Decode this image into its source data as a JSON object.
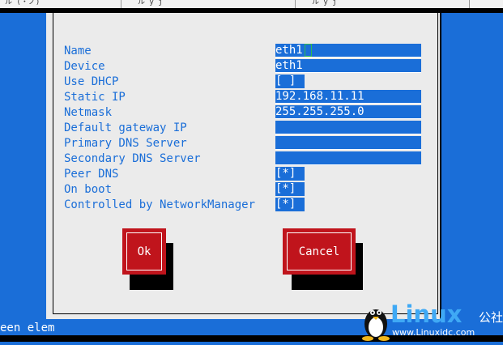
{
  "window": {
    "tabs": [
      {
        "label": "ル     (・ノ)"
      },
      {
        "label": "ル       y   j"
      },
      {
        "label": "ル       y   j"
      }
    ]
  },
  "form": {
    "fields": [
      {
        "label": "Name",
        "value": "eth1",
        "type": "text"
      },
      {
        "label": "Device",
        "value": "eth1",
        "type": "text"
      },
      {
        "label": "Use DHCP",
        "value": "[ ]",
        "type": "checkbox"
      },
      {
        "label": "Static IP",
        "value": "192.168.11.11",
        "type": "text"
      },
      {
        "label": "Netmask",
        "value": "255.255.255.0",
        "type": "text"
      },
      {
        "label": "Default gateway IP",
        "value": "",
        "type": "text"
      },
      {
        "label": "Primary DNS Server",
        "value": "",
        "type": "text"
      },
      {
        "label": "Secondary DNS Server",
        "value": "",
        "type": "text"
      },
      {
        "label": "Peer DNS",
        "value": "[*]",
        "type": "checkbox"
      },
      {
        "label": "On boot",
        "value": "[*]",
        "type": "checkbox"
      },
      {
        "label": "Controlled by NetworkManager",
        "value": "[*]",
        "type": "checkbox"
      }
    ]
  },
  "buttons": {
    "ok": "Ok",
    "cancel": "Cancel"
  },
  "status": {
    "text": "een elem"
  },
  "watermark": {
    "brand": "Linux",
    "cn": "公社",
    "url": "www.Linuxidc.com"
  },
  "colors": {
    "terminal_blue": "#1a6ed8",
    "dialog_gray": "#ebebeb",
    "button_red": "#c0141c"
  }
}
